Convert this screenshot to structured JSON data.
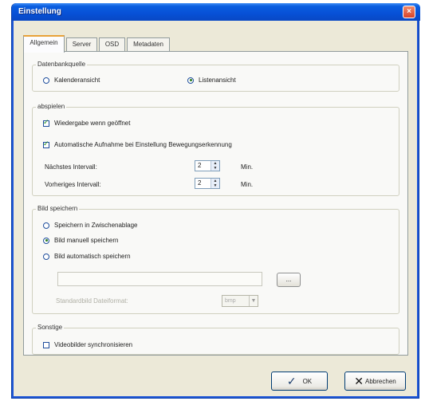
{
  "window": {
    "title": "Einstellung",
    "close_icon": "close-icon"
  },
  "tabs": [
    {
      "label": "Allgemein",
      "active": true
    },
    {
      "label": "Server",
      "active": false
    },
    {
      "label": "OSD",
      "active": false
    },
    {
      "label": "Metadaten",
      "active": false
    }
  ],
  "datenbankquelle": {
    "legend": "Datenbankquelle",
    "options": [
      {
        "label": "Kalenderansicht",
        "selected": false
      },
      {
        "label": "Listenansicht",
        "selected": true
      }
    ]
  },
  "abspielen": {
    "legend": "abspielen",
    "options": [
      {
        "label": "Wiedergabe wenn geöffnet",
        "checked": true
      },
      {
        "label": "Automatische Aufnahme bei Einstellung Bewegungserkennung",
        "checked": true
      }
    ],
    "intervals": [
      {
        "label": "Nächstes Intervall:",
        "value": "2",
        "unit": "Min."
      },
      {
        "label": "Vorheriges Intervall:",
        "value": "2",
        "unit": "Min."
      }
    ]
  },
  "bild_speichern": {
    "legend": "Bild speichern",
    "options": [
      {
        "label": "Speichern in Zwischenablage",
        "selected": false
      },
      {
        "label": "Bild manuell speichern",
        "selected": true
      },
      {
        "label": "Bild automatisch speichern",
        "selected": false
      }
    ],
    "browse_label": "...",
    "format_label": "Standardbild Dateiformat:",
    "format_value": "bmp"
  },
  "sonstige": {
    "legend": "Sonstige",
    "options": [
      {
        "label": "Videobilder synchronisieren",
        "checked": false
      }
    ]
  },
  "footer": {
    "ok_label": "OK",
    "ok_icon": "check-icon",
    "cancel_label": "Abbrechen",
    "cancel_icon": "x-icon"
  }
}
